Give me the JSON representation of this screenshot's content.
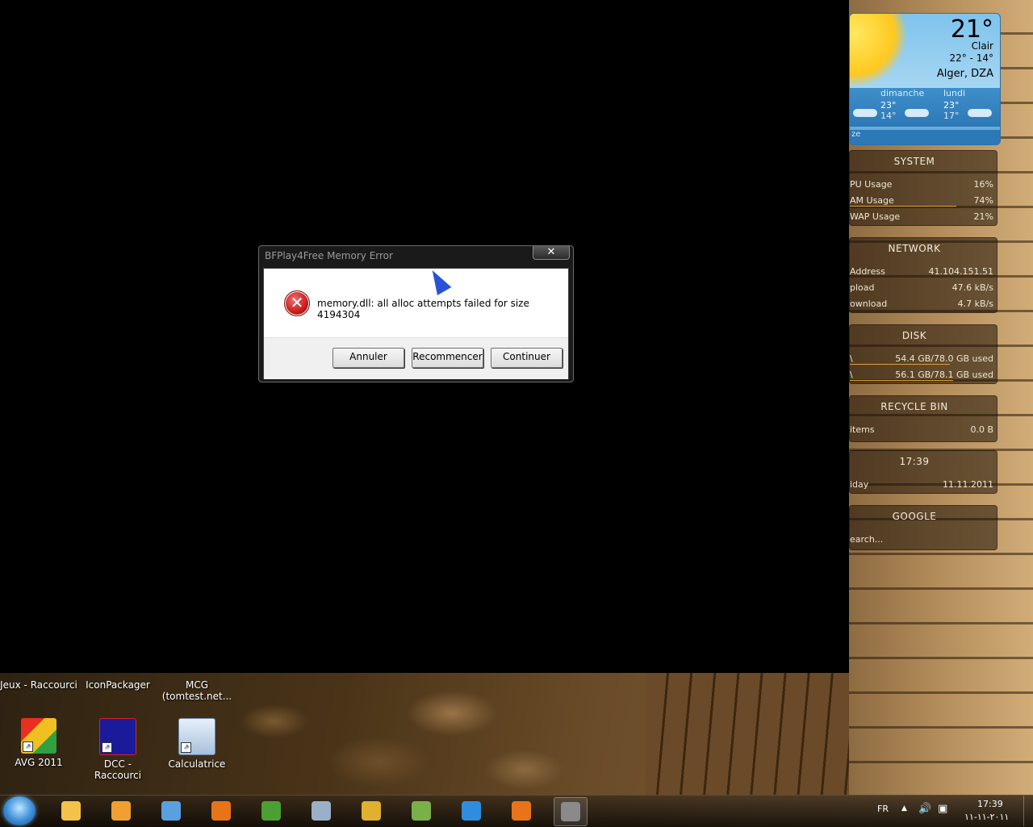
{
  "dialog": {
    "title": "BFPlay4Free Memory Error",
    "close_symbol": "✕",
    "message": "memory.dll: all alloc attempts failed for size 4194304",
    "error_icon": "error-x-icon",
    "buttons": {
      "cancel": "Annuler",
      "retry": "Recommencer",
      "continue": "Continuer"
    }
  },
  "weather": {
    "temp": "21°",
    "condition": "Clair",
    "range": "22° - 14°",
    "city": "Alger, DZA",
    "days": [
      {
        "name": "dimanche",
        "high": "23°",
        "low": "14°"
      },
      {
        "name": "lundi",
        "high": "23°",
        "low": "17°"
      }
    ],
    "footer": "ze"
  },
  "system": {
    "title": "SYSTEM",
    "rows": [
      {
        "label": "PU Usage",
        "value": "16%",
        "level": 0.16
      },
      {
        "label": "AM Usage",
        "value": "74%",
        "level": 0.74
      },
      {
        "label": "WAP Usage",
        "value": "21%",
        "level": 0.21
      }
    ]
  },
  "network": {
    "title": "NETWORK",
    "rows": [
      {
        "label": "Address",
        "value": "41.104.151.51"
      },
      {
        "label": "pload",
        "value": "47.6 kB/s"
      },
      {
        "label": "ownload",
        "value": "4.7 kB/s"
      }
    ]
  },
  "disk": {
    "title": "DISK",
    "rows": [
      {
        "label": "\\",
        "value": "54.4 GB/78.0 GB used",
        "level": 0.7
      },
      {
        "label": "\\",
        "value": "56.1 GB/78.1 GB used",
        "level": 0.72
      }
    ]
  },
  "recycle": {
    "title": "RECYCLE BIN",
    "items": "items",
    "size": "0.0 B"
  },
  "clock": {
    "time": "17:39",
    "day": "iday",
    "date": "11.11.2011"
  },
  "google": {
    "title": "GOOGLE",
    "placeholder": "earch..."
  },
  "desktop_icons_row1": [
    {
      "label": "Jeux - Raccourci"
    },
    {
      "label": "IconPackager"
    },
    {
      "label": "MCG (tomtest.net..."
    }
  ],
  "desktop_icons_row2": [
    {
      "label": "AVG 2011",
      "icon": "avg-icon"
    },
    {
      "label": "DCC - Raccourci",
      "icon": "satellite-dish-icon"
    },
    {
      "label": "Calculatrice",
      "icon": "calculator-icon"
    }
  ],
  "taskbar": {
    "start_icon": "windows-start-icon",
    "apps": [
      {
        "name": "explorer-icon",
        "color": "#f3c24a"
      },
      {
        "name": "media-player-icon",
        "color": "#f0a030"
      },
      {
        "name": "network-icon",
        "color": "#5aa0e0"
      },
      {
        "name": "firefox-icon",
        "color": "#e8741a"
      },
      {
        "name": "game-icon",
        "color": "#4aa030"
      },
      {
        "name": "installer-icon",
        "color": "#9ab0c8"
      },
      {
        "name": "folder-tool-icon",
        "color": "#e0b030"
      },
      {
        "name": "search-tool-icon",
        "color": "#7ab048"
      },
      {
        "name": "internet-explorer-icon",
        "color": "#2f8de0"
      },
      {
        "name": "firefox-icon",
        "color": "#e8741a"
      },
      {
        "name": "window-icon",
        "color": "#8a8a8a"
      }
    ],
    "lang": "FR",
    "time": "17:39",
    "date": "٢٠١١-١١-١١"
  }
}
